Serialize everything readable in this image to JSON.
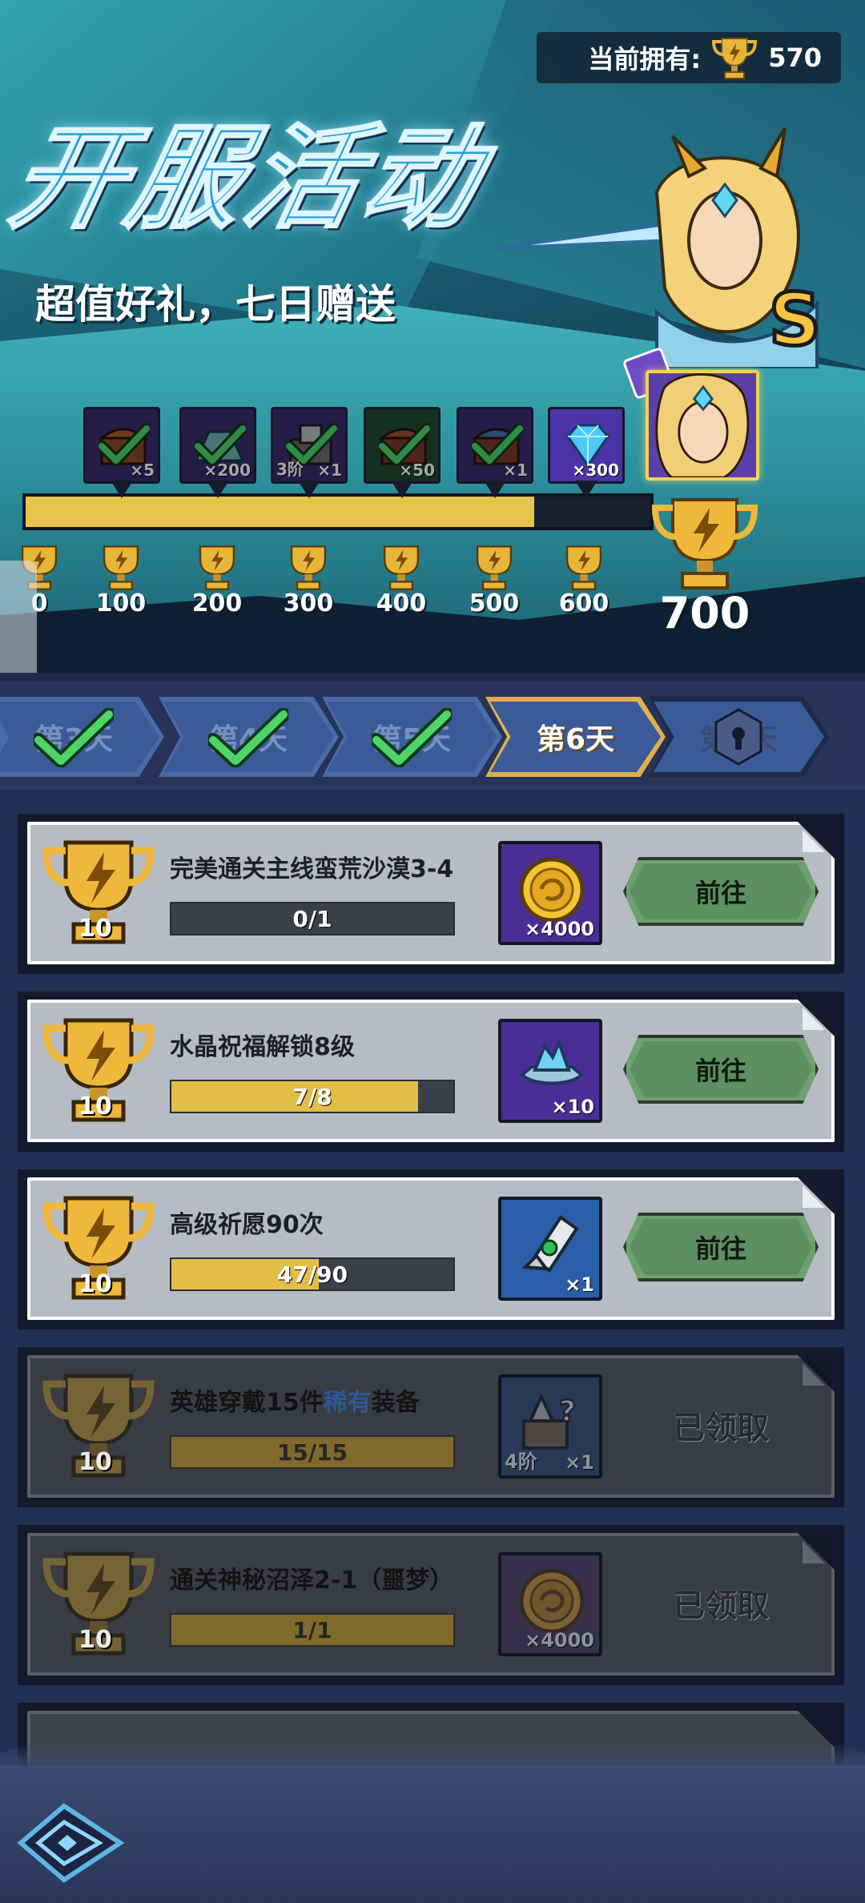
{
  "header": {
    "owned_label": "当前拥有:",
    "owned_count": "570",
    "event_title": "开服活动",
    "event_subtitle": "超值好礼，七日赠送"
  },
  "colors": {
    "gold": "#e6c34a",
    "go_button": "#6fa070",
    "active_tab": "#e0b04c",
    "epic_purple": "#4b2d98"
  },
  "progress": {
    "current": 570,
    "max": 700,
    "fraction": 0.814
  },
  "milestone_rewards": [
    {
      "icon": "chest-icon",
      "qty": "×5",
      "tier": "",
      "claimed": true
    },
    {
      "icon": "gem-pile-icon",
      "qty": "×200",
      "tier": "",
      "claimed": true
    },
    {
      "icon": "equipment-chest-icon",
      "qty": "×1",
      "tier": "3阶",
      "claimed": true
    },
    {
      "icon": "green-chest-icon",
      "qty": "×50",
      "tier": "",
      "claimed": true
    },
    {
      "icon": "blue-chest-icon",
      "qty": "×1",
      "tier": "",
      "claimed": true
    },
    {
      "icon": "diamond-icon",
      "qty": "×300",
      "tier": "",
      "claimed": false
    }
  ],
  "hero_reward": {
    "icon": "hero-portrait-icon",
    "grade": "S"
  },
  "milestones": [
    "0",
    "100",
    "200",
    "300",
    "400",
    "500",
    "600"
  ],
  "final_milestone": "700",
  "day_tabs": [
    {
      "label": "第3天",
      "state": "done"
    },
    {
      "label": "第4天",
      "state": "done"
    },
    {
      "label": "第5天",
      "state": "done"
    },
    {
      "label": "第6天",
      "state": "active"
    },
    {
      "label": "第7天",
      "state": "locked"
    }
  ],
  "quests": [
    {
      "points": "10",
      "title": "完美通关主线蛮荒沙漠3-4",
      "progress_text": "0/1",
      "progress_fraction": 0.0,
      "reward_icon": "gold-coin-icon",
      "reward_qty": "×4000",
      "reward_tier": "",
      "action": "前往",
      "claimed": false
    },
    {
      "points": "10",
      "title": "水晶祝福解锁8级",
      "progress_text": "7/8",
      "progress_fraction": 0.875,
      "reward_icon": "crystal-icon",
      "reward_qty": "×10",
      "reward_tier": "",
      "action": "前往",
      "claimed": false
    },
    {
      "points": "10",
      "title": "高级祈愿90次",
      "progress_text": "47/90",
      "progress_fraction": 0.522,
      "reward_icon": "scroll-icon",
      "reward_qty": "×1",
      "reward_tier": "",
      "action": "前往",
      "claimed": false
    },
    {
      "points": "10",
      "title_prefix": "英雄穿戴15件",
      "title_rare": "稀有",
      "title_suffix": "装备",
      "progress_text": "15/15",
      "progress_fraction": 1.0,
      "reward_icon": "mystery-chest-icon",
      "reward_qty": "×1",
      "reward_tier": "4阶",
      "action": "已领取",
      "claimed": true
    },
    {
      "points": "10",
      "title": "通关神秘沼泽2-1（噩梦）",
      "progress_text": "1/1",
      "progress_fraction": 1.0,
      "reward_icon": "gold-coin-icon",
      "reward_qty": "×4000",
      "reward_tier": "",
      "action": "已领取",
      "claimed": true
    }
  ],
  "footer": {
    "back_icon": "back-arrow-icon"
  }
}
